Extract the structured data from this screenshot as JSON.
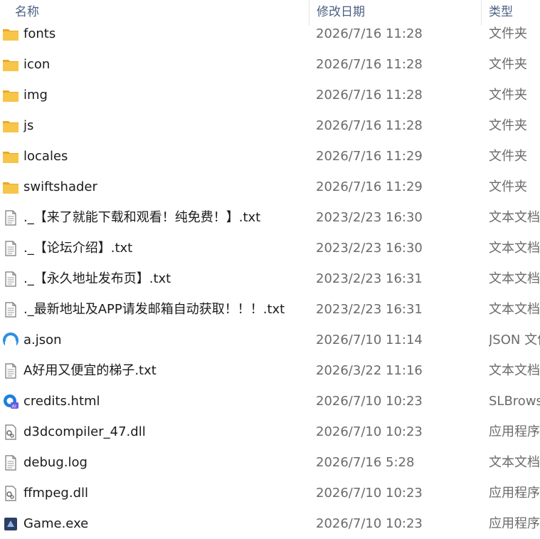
{
  "header": {
    "name_label": "名称",
    "date_label": "修改日期",
    "type_label": "类型",
    "sort_arrow": "^"
  },
  "rows": [
    {
      "name": "fonts",
      "date": "2026/7/16 11:28",
      "type": "文件夹",
      "icon": "folder-icon"
    },
    {
      "name": "icon",
      "date": "2026/7/16 11:28",
      "type": "文件夹",
      "icon": "folder-icon"
    },
    {
      "name": "img",
      "date": "2026/7/16 11:28",
      "type": "文件夹",
      "icon": "folder-icon"
    },
    {
      "name": "js",
      "date": "2026/7/16 11:28",
      "type": "文件夹",
      "icon": "folder-icon"
    },
    {
      "name": "locales",
      "date": "2026/7/16 11:29",
      "type": "文件夹",
      "icon": "folder-icon"
    },
    {
      "name": "swiftshader",
      "date": "2026/7/16 11:29",
      "type": "文件夹",
      "icon": "folder-icon"
    },
    {
      "name": "._【来了就能下载和观看！纯免费！】.txt",
      "date": "2023/2/23 16:30",
      "type": "文本文档",
      "icon": "text-file-icon"
    },
    {
      "name": "._【论坛介绍】.txt",
      "date": "2023/2/23 16:30",
      "type": "文本文档",
      "icon": "text-file-icon"
    },
    {
      "name": "._【永久地址发布页】.txt",
      "date": "2023/2/23 16:31",
      "type": "文本文档",
      "icon": "text-file-icon"
    },
    {
      "name": "._最新地址及APP请发邮箱自动获取！！！.txt",
      "date": "2023/2/23 16:31",
      "type": "文本文档",
      "icon": "text-file-icon"
    },
    {
      "name": "a.json",
      "date": "2026/7/10 11:14",
      "type": "JSON 文件",
      "icon": "json-file-icon"
    },
    {
      "name": "A好用又便宜的梯子.txt",
      "date": "2026/3/22 11:16",
      "type": "文本文档",
      "icon": "text-file-icon"
    },
    {
      "name": "credits.html",
      "date": "2026/7/10 10:23",
      "type": "SLBrowser",
      "icon": "html-file-icon"
    },
    {
      "name": "d3dcompiler_47.dll",
      "date": "2026/7/10 10:23",
      "type": "应用程序扩展",
      "icon": "dll-file-icon"
    },
    {
      "name": "debug.log",
      "date": "2026/7/16 5:28",
      "type": "文本文档",
      "icon": "text-file-icon"
    },
    {
      "name": "ffmpeg.dll",
      "date": "2026/7/10 10:23",
      "type": "应用程序扩展",
      "icon": "dll-file-icon"
    },
    {
      "name": "Game.exe",
      "date": "2026/7/10 10:23",
      "type": "应用程序",
      "icon": "exe-file-icon"
    }
  ],
  "colors": {
    "header_text": "#4d6082",
    "name_text": "#1b1b1b",
    "meta_text": "#6b6b6b",
    "folder": "#f7c547",
    "json_icon": "#2f8ee5",
    "exe_icon": "#2c3e63"
  }
}
